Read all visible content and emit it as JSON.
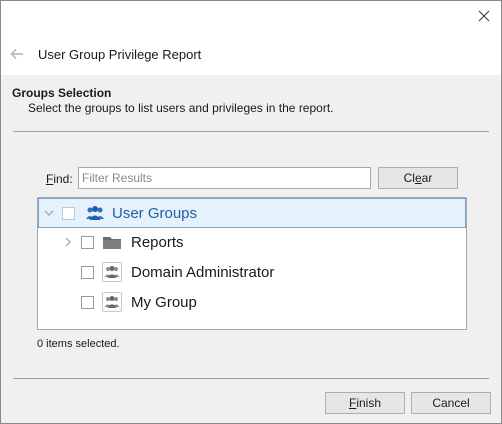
{
  "dialog": {
    "title": "User Group Privilege Report"
  },
  "section": {
    "title": "Groups Selection",
    "description": "Select the groups to list users and privileges in the report."
  },
  "find": {
    "label_prefix": "F",
    "label_rest": "ind:",
    "placeholder": "Filter Results",
    "value": "",
    "clear_label_pre": "Cl",
    "clear_label_u": "e",
    "clear_label_post": "ar"
  },
  "tree": {
    "items": [
      {
        "label": "User Groups",
        "icon": "user-group-icon",
        "checked": false,
        "expanded": true,
        "selected": true
      },
      {
        "label": "Reports",
        "icon": "folder-icon",
        "checked": false,
        "expanded": false,
        "selected": false
      },
      {
        "label": "Domain Administrator",
        "icon": "group-icon",
        "checked": false,
        "selected": false
      },
      {
        "label": "My Group",
        "icon": "group-icon",
        "checked": false,
        "selected": false
      }
    ]
  },
  "status_text": "0 items selected.",
  "footer": {
    "finish_u": "F",
    "finish_rest": "inish",
    "cancel_label": "Cancel"
  },
  "colors": {
    "accent_blue": "#1f5fa8",
    "selection_bg": "#e5f1fb",
    "panel_bg": "#f0f0f0"
  }
}
